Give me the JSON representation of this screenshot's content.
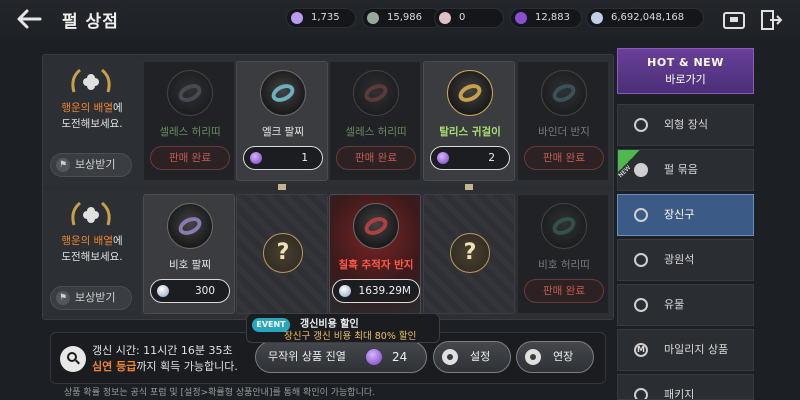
{
  "header": {
    "title": "펄 상점"
  },
  "currencies": [
    {
      "name": "purple-gem",
      "value": "1,735",
      "color": "#b79cf0"
    },
    {
      "name": "green-orb",
      "value": "15,986",
      "color": "#9aa89a"
    },
    {
      "name": "pink-pearl",
      "value": "0",
      "color": "#e0c0c0"
    },
    {
      "name": "violet-orb",
      "value": "12,883",
      "color": "#8a4fd0"
    },
    {
      "name": "silver-coin",
      "value": "6,692,048,168",
      "color": "#c0d0e8"
    }
  ],
  "grid": {
    "row1": {
      "prompt": {
        "highlight": "행운의 배열",
        "rest": "에",
        "line2": "도전해보세요."
      },
      "reward_label": "보상받기",
      "cards": [
        {
          "name": "셀레스 허리띠",
          "status": "판매 완료"
        },
        {
          "name": "엘크 팔찌",
          "price": "1",
          "currency": "purple"
        },
        {
          "name": "셀레스 허리띠",
          "status": "판매 완료"
        },
        {
          "name": "탈리스 귀걸이",
          "price": "2",
          "currency": "purple"
        },
        {
          "name": "바인더 반지",
          "status": "판매 완료"
        }
      ]
    },
    "row2": {
      "prompt": {
        "highlight": "행운의 배열",
        "rest": "에",
        "line2": "도전해보세요."
      },
      "reward_label": "보상받기",
      "cards": [
        {
          "name": "비호 팔찌",
          "price": "300",
          "currency": "silver"
        },
        {
          "name": "?"
        },
        {
          "name": "칠흑 추적자 반지",
          "price": "1639.29M",
          "currency": "silver"
        },
        {
          "name": "?"
        },
        {
          "name": "비호 허리띠",
          "status": "판매 완료"
        }
      ]
    }
  },
  "sidebar": {
    "hot": {
      "line1": "HOT & NEW",
      "line2": "바로가기"
    },
    "new_tag": "NEW",
    "items": [
      {
        "label": "외형 장식",
        "icon": "costume-icon"
      },
      {
        "label": "펄 묶음",
        "icon": "pearl-bundle-icon"
      },
      {
        "label": "장신구",
        "icon": "ring-icon",
        "active": true
      },
      {
        "label": "광원석",
        "icon": "ore-icon"
      },
      {
        "label": "유물",
        "icon": "relic-icon"
      },
      {
        "label": "마일리지 상품",
        "icon": "mileage-icon"
      },
      {
        "label": "패키지",
        "icon": "package-icon"
      }
    ]
  },
  "bottom": {
    "refresh_time": "갱신 시간: 11시간 16분 35초",
    "grade_highlight": "심연 등급",
    "grade_rest": "까지 획득 가능합니다.",
    "random_display_label": "무작위 상품 진열",
    "random_display_cost": "24",
    "settings_label": "설정",
    "extend_label": "연장",
    "event_badge": "EVENT",
    "event_title": "갱신비용 할인",
    "event_desc": "장신구 갱신 비용 최대 80% 할인",
    "footnote": "상품 확률 정보는 공식 포럼 및 [설정>확률형 상품안내]를 통해 확인이 가능합니다."
  }
}
